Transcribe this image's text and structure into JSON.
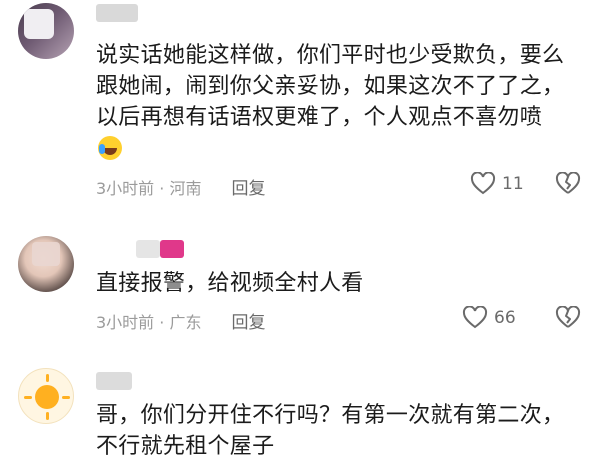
{
  "comments": [
    {
      "text_main": "说实话她能这样做，你们平时也少受欺负，要么跟她闹，闹到你父亲妥协，如果这次不了了之，以后再想有话语权更难了，个人观点不喜勿喷",
      "emoji": "laughing-with-tears",
      "meta": "3小时前 · 河南",
      "reply_label": "回复",
      "likes": "11"
    },
    {
      "text_main": "直接报警，给视频全村人看",
      "meta": "3小时前 · 广东",
      "reply_label": "回复",
      "likes": "66"
    },
    {
      "text_main": "哥，你们分开住不行吗？有第一次就有第二次，不行就先租个屋子"
    }
  ],
  "colors": {
    "text": "#1b1b1b",
    "meta": "#9b9b9b",
    "action": "#6a6a6a",
    "name_pink": "#e0388a"
  }
}
